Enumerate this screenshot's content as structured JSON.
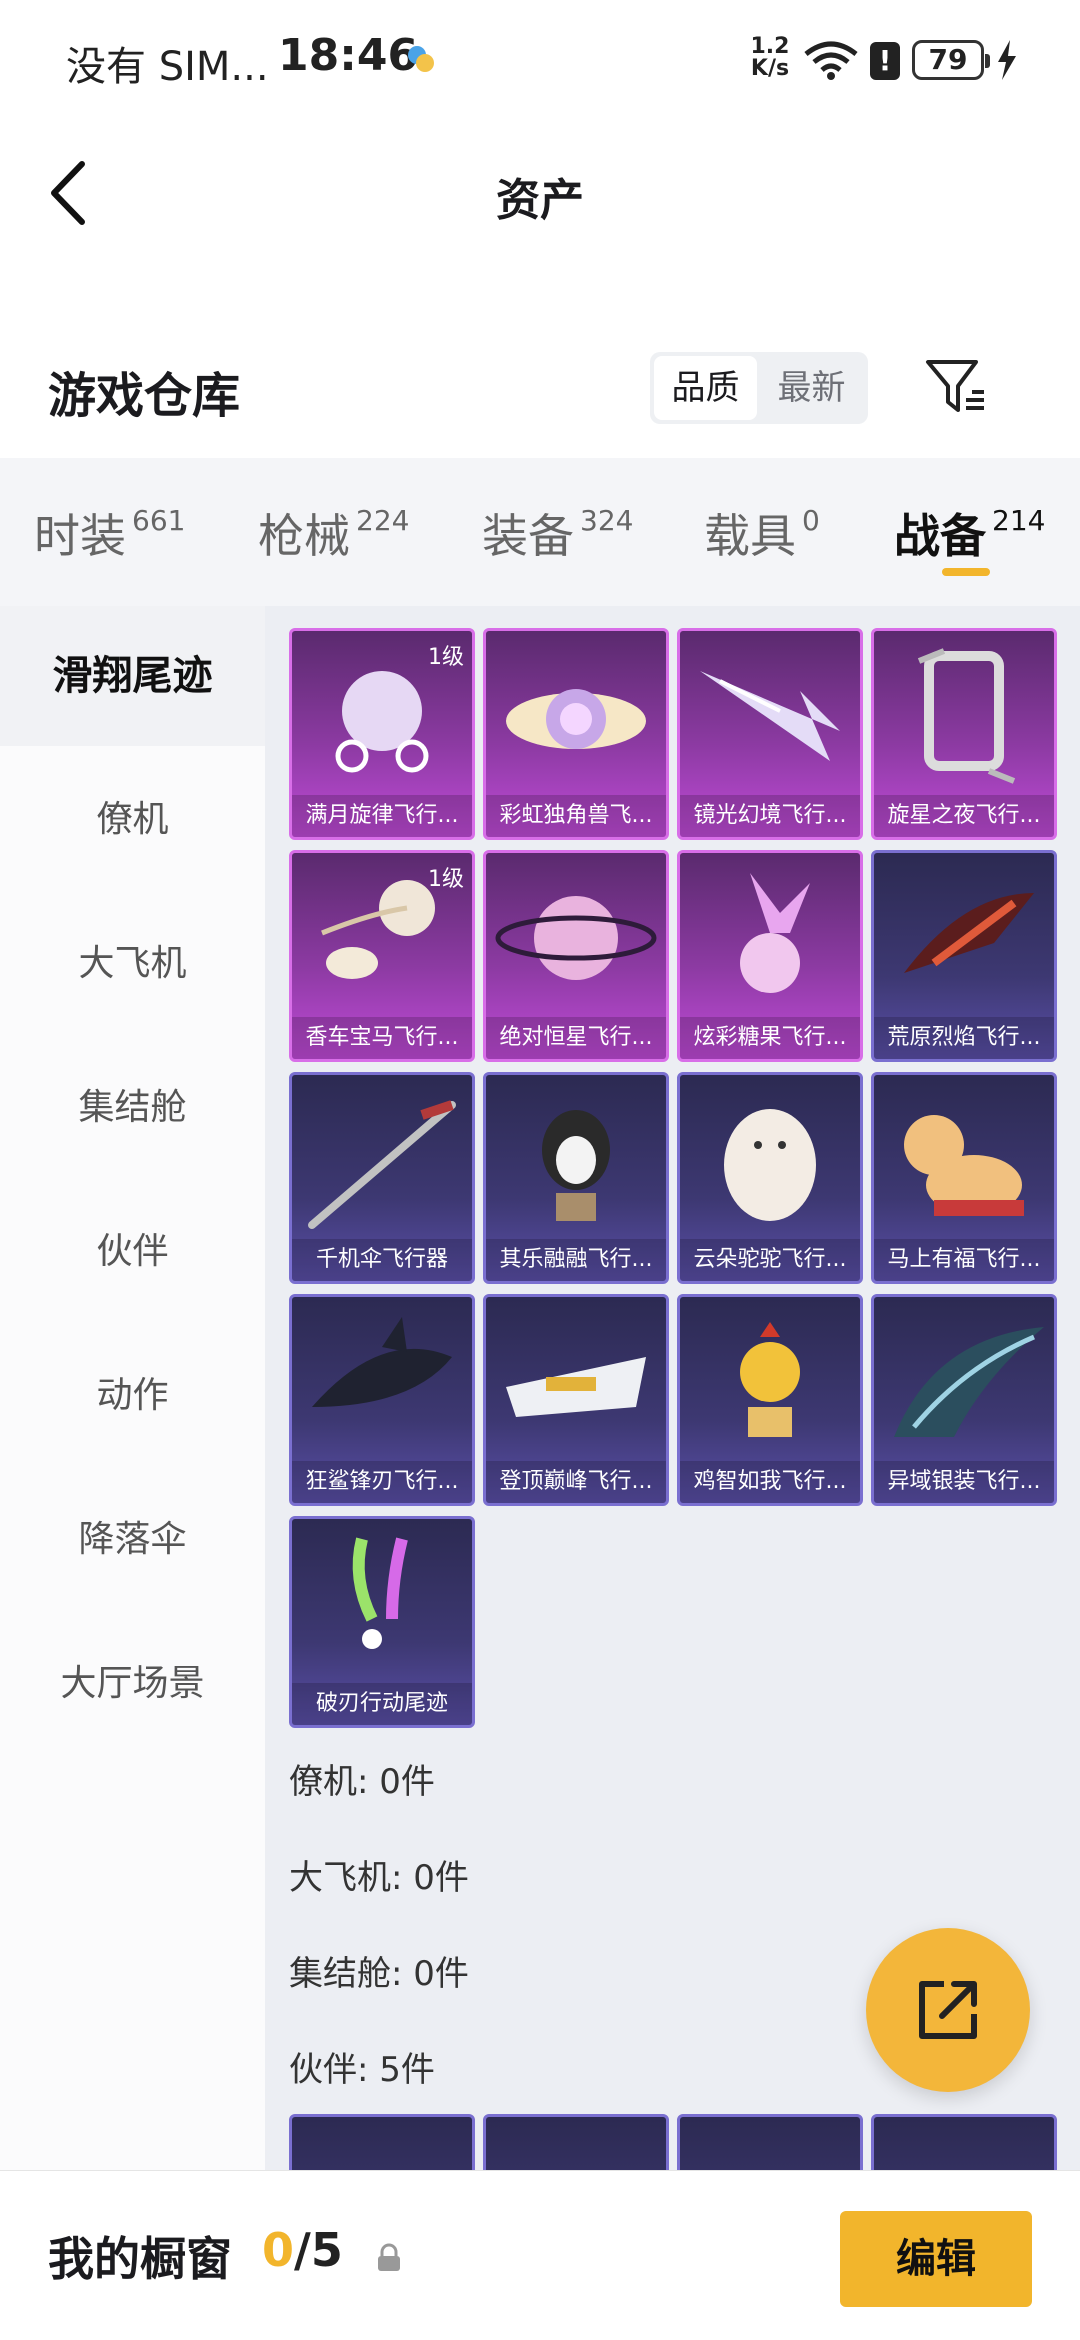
{
  "status_bar": {
    "carrier": "没有 SIM...",
    "time": "18:46",
    "net_rate_top": "1.2",
    "net_rate_bottom": "K/s",
    "battery": "79"
  },
  "header": {
    "title": "资产"
  },
  "section": {
    "title": "游戏仓库",
    "sort_options": [
      "品质",
      "最新"
    ]
  },
  "tabs": [
    {
      "label": "时装",
      "count": "661"
    },
    {
      "label": "枪械",
      "count": "224"
    },
    {
      "label": "装备",
      "count": "324"
    },
    {
      "label": "载具",
      "count": "0"
    },
    {
      "label": "战备",
      "count": "214"
    }
  ],
  "sidebar": {
    "items": [
      "滑翔尾迹",
      "僚机",
      "大飞机",
      "集结舱",
      "伙伴",
      "动作",
      "降落伞",
      "大厅场景"
    ]
  },
  "items": [
    {
      "name": "满月旋律飞行...",
      "level": "1级",
      "rarity": "purple",
      "icon": "carriage-icon"
    },
    {
      "name": "彩虹独角兽飞...",
      "level": "",
      "rarity": "purple",
      "icon": "winged-orb-icon"
    },
    {
      "name": "镜光幻境飞行...",
      "level": "",
      "rarity": "purple",
      "icon": "crystal-wing-icon"
    },
    {
      "name": "旋星之夜飞行...",
      "level": "",
      "rarity": "purple",
      "icon": "frame-icon"
    },
    {
      "name": "香车宝马飞行...",
      "level": "1级",
      "rarity": "purple",
      "icon": "horse-carriage-icon"
    },
    {
      "name": "绝对恒星飞行...",
      "level": "",
      "rarity": "purple",
      "icon": "planet-icon"
    },
    {
      "name": "炫彩糖果飞行...",
      "level": "",
      "rarity": "purple",
      "icon": "candy-icon"
    },
    {
      "name": "荒原烈焰飞行...",
      "level": "",
      "rarity": "blue",
      "icon": "flame-wing-icon"
    },
    {
      "name": "千机伞飞行器",
      "level": "",
      "rarity": "blue",
      "icon": "umbrella-icon"
    },
    {
      "name": "其乐融融飞行...",
      "level": "",
      "rarity": "blue",
      "icon": "penguin-icon"
    },
    {
      "name": "云朵驼驼飞行...",
      "level": "",
      "rarity": "blue",
      "icon": "alpaca-icon"
    },
    {
      "name": "马上有福飞行...",
      "level": "",
      "rarity": "blue",
      "icon": "pony-icon"
    },
    {
      "name": "狂鲨锋刃飞行...",
      "level": "",
      "rarity": "blue",
      "icon": "shark-icon"
    },
    {
      "name": "登顶巅峰飞行...",
      "level": "",
      "rarity": "blue",
      "icon": "jet-icon"
    },
    {
      "name": "鸡智如我飞行...",
      "level": "",
      "rarity": "blue",
      "icon": "chicken-icon"
    },
    {
      "name": "异域银装飞行...",
      "level": "",
      "rarity": "blue",
      "icon": "blade-wing-icon"
    },
    {
      "name": "破刃行动尾迹",
      "level": "",
      "rarity": "blue",
      "icon": "smoke-trail-icon"
    }
  ],
  "summaries": [
    "僚机: 0件",
    "大飞机: 0件",
    "集结舱: 0件",
    "伙伴: 5件"
  ],
  "bottom_bar": {
    "label": "我的橱窗",
    "current": "0",
    "total": "/5",
    "edit_label": "编辑"
  },
  "colors": {
    "accent": "#f2b52c",
    "purple_rarity": "#c04bd8",
    "blue_rarity": "#5a4fa8"
  }
}
